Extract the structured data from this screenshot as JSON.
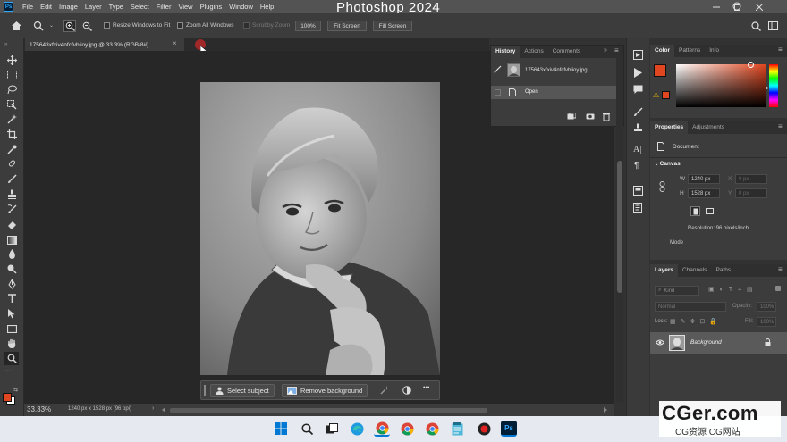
{
  "app": {
    "title": "Photoshop 2024",
    "logo": "Ps",
    "menu": [
      "File",
      "Edit",
      "Image",
      "Layer",
      "Type",
      "Select",
      "Filter",
      "View",
      "Plugins",
      "Window",
      "Help"
    ]
  },
  "options_bar": {
    "resize_windows": "Resize Windows to Fit",
    "zoom_all": "Zoom All Windows",
    "scrubby_zoom": "Scrubby Zoom",
    "zoom_value": "100%",
    "fit_screen": "Fit Screen",
    "fill_screen": "Fill Screen"
  },
  "document": {
    "tab_title": "175643xfxiv4nfcfvbiioy.jpg @ 33.3% (RGB/8#)",
    "close": "×"
  },
  "context_bar": {
    "select_subject": "Select subject",
    "remove_background": "Remove background",
    "more": "•••"
  },
  "status_bar": {
    "zoom": "33.33%",
    "dimensions": "1240 px x 1528 px (96 ppi)",
    "arrow": "›"
  },
  "history_panel": {
    "tabs": [
      "History",
      "Actions",
      "Comments"
    ],
    "snapshot_name": "175643xfxiv4nfcfvbiioy.jpg",
    "steps": [
      "Open"
    ]
  },
  "color_panel": {
    "tabs": [
      "Color",
      "Patterns",
      "Info"
    ],
    "foreground": "#e0461f",
    "background": "#ffffff"
  },
  "properties_panel": {
    "tabs": [
      "Properties",
      "Adjustments"
    ],
    "kind": "Document",
    "section": "Canvas",
    "w_label": "W",
    "w_value": "1240 px",
    "h_label": "H",
    "h_value": "1528 px",
    "x_label": "X",
    "x_value": "0 px",
    "y_label": "Y",
    "y_value": "0 px",
    "resolution": "Resolution: 96 pixels/inch",
    "mode": "Mode"
  },
  "layers_panel": {
    "tabs": [
      "Layers",
      "Channels",
      "Paths"
    ],
    "filter": "Kind",
    "blend_mode": "Normal",
    "opacity_label": "Opacity:",
    "opacity_value": "100%",
    "lock_label": "Lock:",
    "fill_label": "Fill:",
    "fill_value": "100%",
    "layers": [
      {
        "name": "Background"
      }
    ]
  },
  "watermark": {
    "brand": "CGer.com",
    "subtitle": "CG资源 CG网站"
  },
  "colors": {
    "accent": "#31a8ff",
    "fg": "#e0461f"
  }
}
